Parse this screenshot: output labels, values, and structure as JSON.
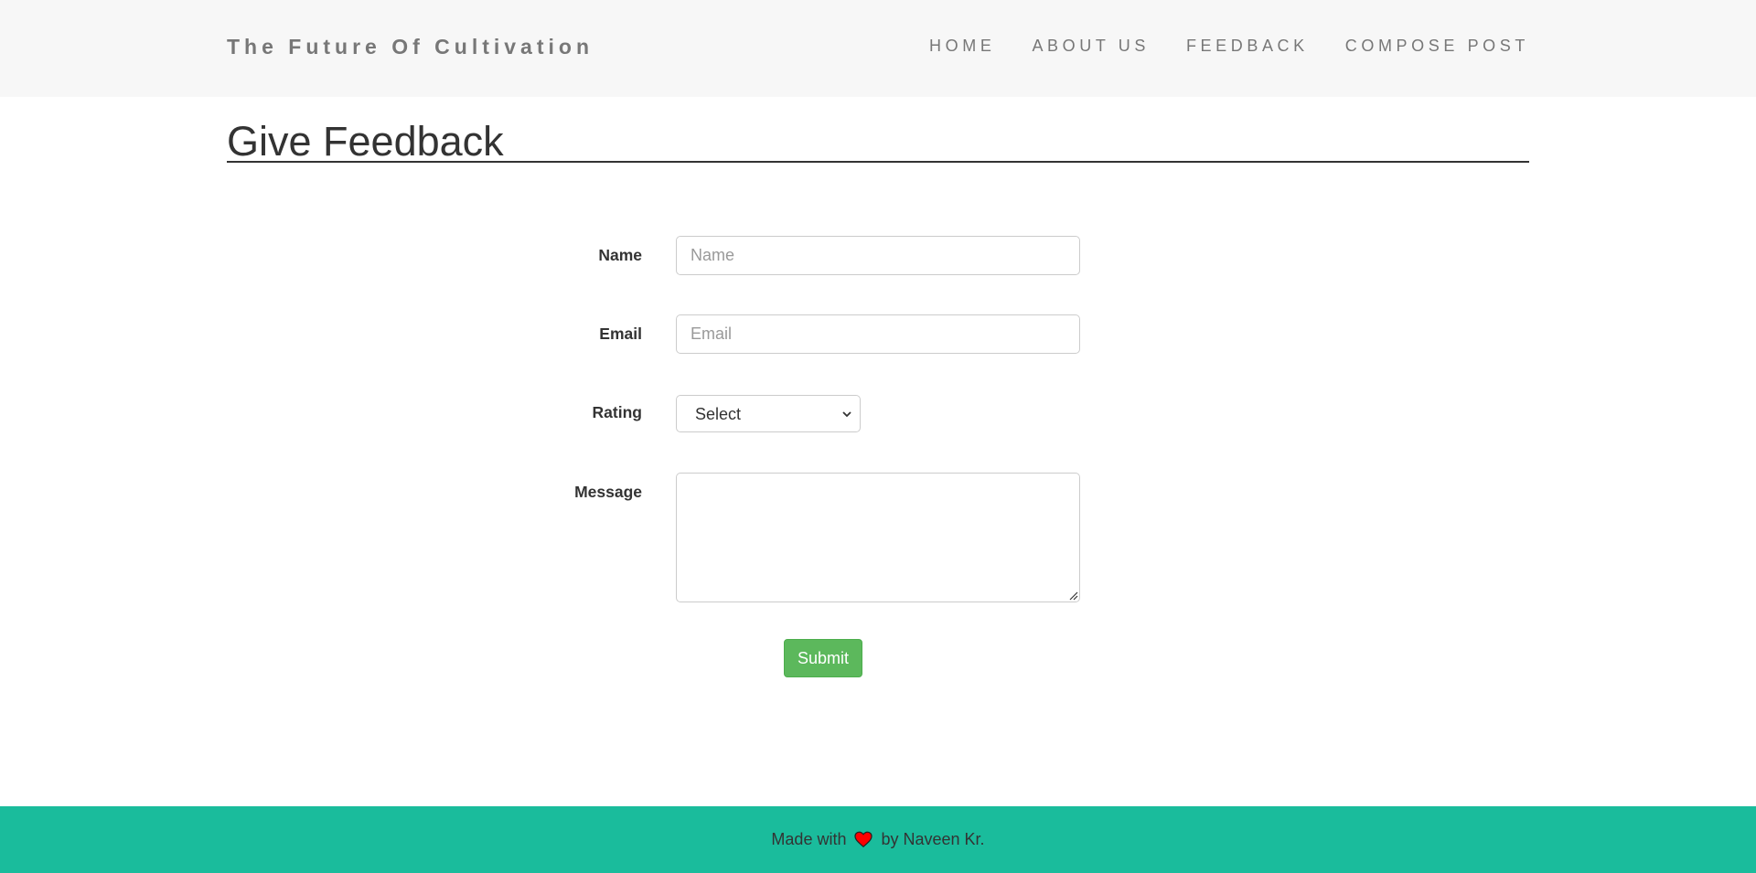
{
  "navbar": {
    "brand": "The Future Of Cultivation",
    "links": [
      "HOME",
      "ABOUT US",
      "FEEDBACK",
      "COMPOSE POST"
    ]
  },
  "page": {
    "title": "Give Feedback"
  },
  "form": {
    "name_label": "Name",
    "name_placeholder": "Name",
    "email_label": "Email",
    "email_placeholder": "Email",
    "rating_label": "Rating",
    "rating_selected": "Select",
    "message_label": "Message",
    "submit_label": "Submit"
  },
  "footer": {
    "prefix": "Made with",
    "suffix": "by Naveen Kr.",
    "heart_icon": "heart-icon",
    "heart_color": "#ff0000"
  },
  "colors": {
    "navbar_bg": "#f7f7f7",
    "footer_bg": "#1abc9c",
    "submit_bg": "#5cb85c"
  }
}
